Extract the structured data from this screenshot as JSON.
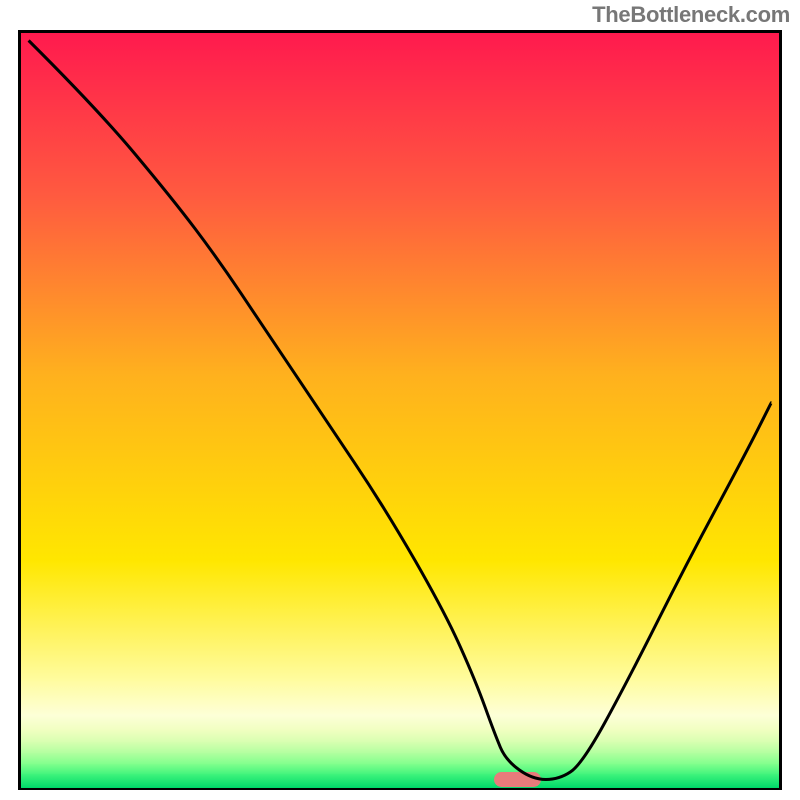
{
  "attribution": "TheBottleneck.com",
  "chart_data": {
    "type": "line",
    "title": "",
    "xlabel": "",
    "ylabel": "",
    "xlim": [
      0,
      100
    ],
    "ylim": [
      0,
      100
    ],
    "series": [
      {
        "name": "curve",
        "x": [
          1,
          10,
          20,
          26,
          32,
          40,
          48,
          56,
          60,
          62.5,
          64,
          67.5,
          71,
          74,
          80,
          88,
          96,
          99
        ],
        "y": [
          99,
          90,
          78,
          70,
          61,
          49,
          37,
          23,
          14,
          7,
          3.5,
          1,
          1,
          3,
          14,
          30,
          45,
          51
        ]
      }
    ],
    "gradient_background": [
      {
        "pct": 0.0,
        "color": "#ff1a4e"
      },
      {
        "pct": 0.22,
        "color": "#ff5c3f"
      },
      {
        "pct": 0.45,
        "color": "#ffb01e"
      },
      {
        "pct": 0.7,
        "color": "#ffe700"
      },
      {
        "pct": 0.86,
        "color": "#fffca1"
      },
      {
        "pct": 0.905,
        "color": "#fdffd8"
      },
      {
        "pct": 0.925,
        "color": "#f0ffc0"
      },
      {
        "pct": 0.94,
        "color": "#d6ffb0"
      },
      {
        "pct": 0.955,
        "color": "#b0ff9f"
      },
      {
        "pct": 0.97,
        "color": "#7fff8c"
      },
      {
        "pct": 0.983,
        "color": "#40f47c"
      },
      {
        "pct": 1.0,
        "color": "#00d96a"
      }
    ],
    "marker": {
      "x": 65.5,
      "y": 1,
      "w": 6.3,
      "h": 2.1,
      "color": "#e87b7b"
    }
  }
}
